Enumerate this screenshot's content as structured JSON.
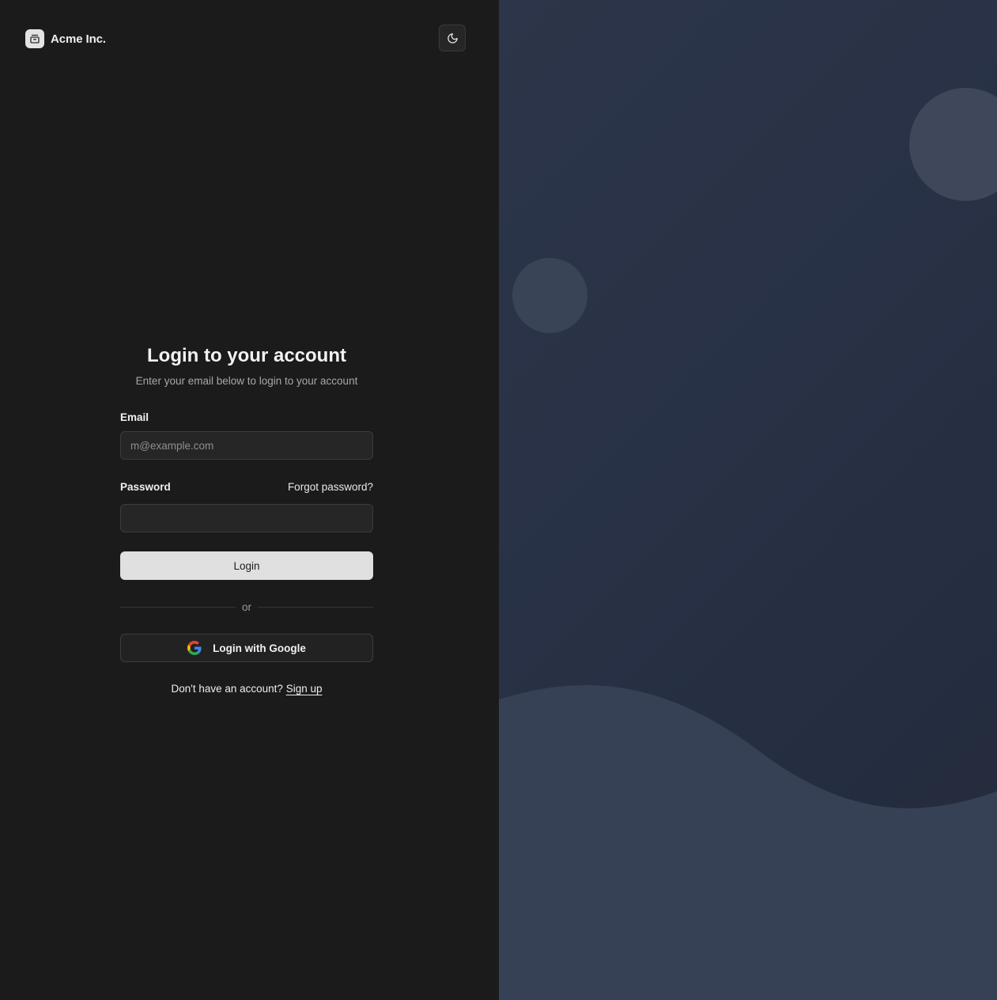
{
  "header": {
    "brand_name": "Acme Inc.",
    "brand_icon": "archive-box-icon",
    "theme_toggle_icon": "moon-icon"
  },
  "form": {
    "title": "Login to your account",
    "subtitle": "Enter your email below to login to your account",
    "email": {
      "label": "Email",
      "placeholder": "m@example.com",
      "value": ""
    },
    "password": {
      "label": "Password",
      "forgot_label": "Forgot password?",
      "value": ""
    },
    "login_label": "Login",
    "divider_label": "or",
    "google_label": "Login with Google",
    "google_icon": "google-icon",
    "signup_prompt": "Don't have an account?",
    "signup_label": "Sign up"
  },
  "colors": {
    "left_background": "#1b1b1b",
    "right_background": "#283145",
    "primary_button": "#e0e0e0",
    "decoration": "#3e485a"
  }
}
